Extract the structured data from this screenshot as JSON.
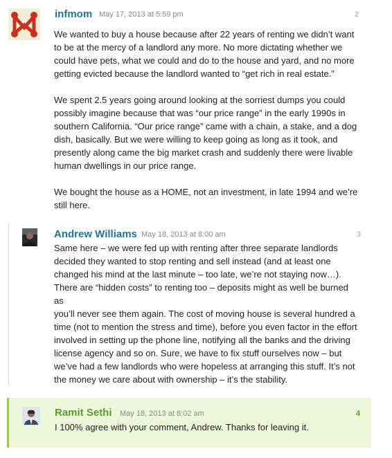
{
  "comments": [
    {
      "author": "infmom",
      "date": "May 17, 2013 at 5:59 pm",
      "number": "2",
      "avatar_icon": "red-knot-avatar-icon",
      "paragraphs": [
        " We wanted to buy a house because after 22 years of renting we didn’t want\nto be at the mercy of a landlord any more. No more dictating whether we\ncould have pets, what we could and do to the house and yard, and no more\ngetting evicted because the landlord wanted to “get rich in real estate.”",
        "We spent 2.5 years going around looking at the sorriest dumps you could\npossibly imagine because that was “our price range” in the early 1990s in\nsouthern California. “Our price range” came with a chain, a stake, and a dog\ndish, basically. But we were willing to keep going as long as it took, and\npresently along came the big market crash and suddenly there were livable\nhuman dwellings in our price range.",
        "We bought the house as a HOME, not an investment, in late 1994 and we’re\nstill here."
      ]
    },
    {
      "author": "Andrew Williams",
      "date": "May 18, 2013 at 8:00 am",
      "number": "3",
      "avatar_icon": "photo-avatar-icon",
      "paragraphs": [
        "Same here – we were fed up with renting after three separate landlords\ndecided they wanted to stop renting and sell instead (and at least one\nchanged his mind at the last minute – too late, we’re not staying now…).\nThere are “hidden costs” to renting too – deposits might as well be burned as\nyou’ll never see them again. The cost of moving house is several hundred a\ntime (not to mention the stress and time), before you even factor in the effort\ninvolved in setting up the phone line, notifying all the banks and the driving\nlicense agency and so on. Sure, we have to fix stuff ourselves now – but\nwe’ve had a few landlords who were hopeless at arranging this stuff. It’s not\nthe money we care about with ownership – it’s the stability."
      ]
    },
    {
      "author": "Ramit Sethi",
      "date": "May 18, 2013 at 8:02 am",
      "number": "4",
      "avatar_icon": "photo-avatar-icon",
      "paragraphs": [
        "I 100% agree with your comment, Andrew. Thanks for leaving it."
      ]
    }
  ],
  "colors": {
    "author_link": "#21759b",
    "author_reply_link": "#5a9d2f",
    "author_reply_background": "#ecf8d9",
    "author_reply_border": "#95c84d",
    "meta_text": "#888888"
  }
}
